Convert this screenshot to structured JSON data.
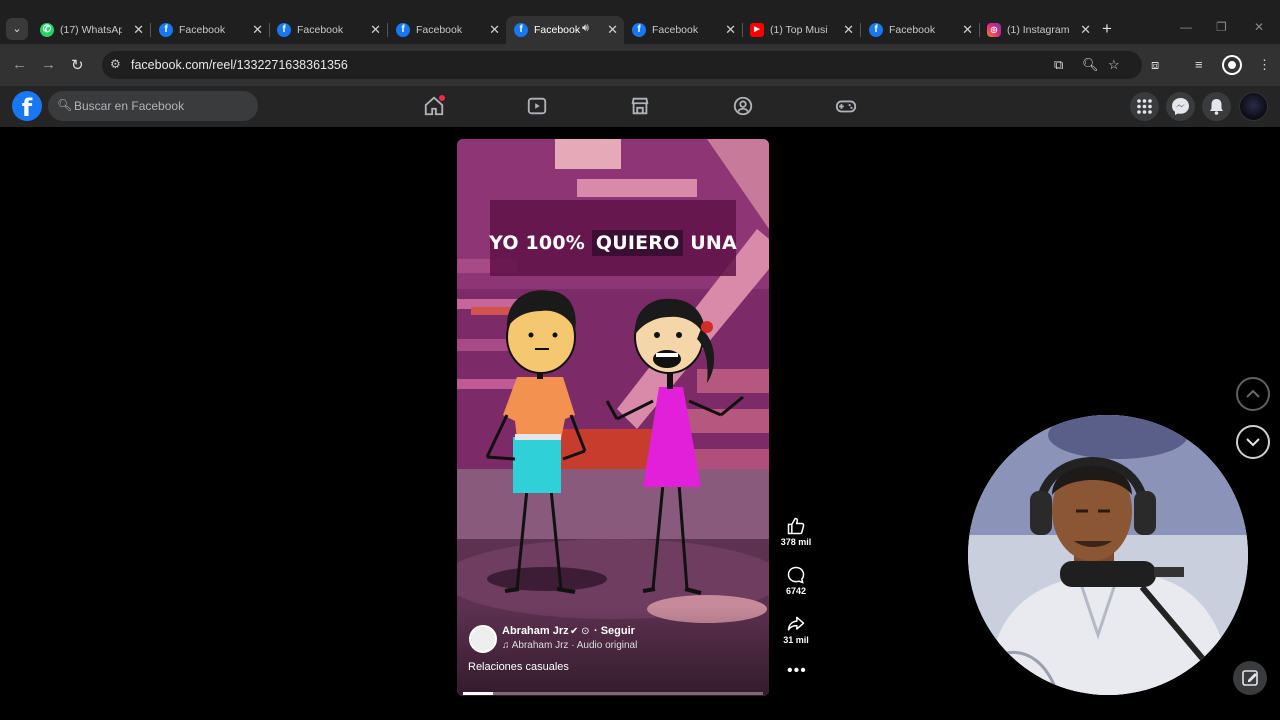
{
  "browser": {
    "tabs": [
      {
        "title": "(17) WhatsApp",
        "favicon": "whatsapp-icon",
        "active": false
      },
      {
        "title": "Facebook",
        "favicon": "facebook-icon",
        "active": false
      },
      {
        "title": "Facebook",
        "favicon": "facebook-icon",
        "active": false
      },
      {
        "title": "Facebook",
        "favicon": "facebook-icon",
        "active": false
      },
      {
        "title": "Facebook",
        "favicon": "facebook-icon",
        "active": true,
        "audio": true
      },
      {
        "title": "Facebook",
        "favicon": "facebook-icon",
        "active": false
      },
      {
        "title": "(1) Top Musi",
        "favicon": "youtube-icon",
        "active": false
      },
      {
        "title": "Facebook",
        "favicon": "facebook-icon",
        "active": false
      },
      {
        "title": "(1) Instagram",
        "favicon": "instagram-icon",
        "active": false
      }
    ],
    "url": "facebook.com/reel/1332271638361356"
  },
  "facebook": {
    "logo": "f",
    "search_placeholder": "Buscar en Facebook"
  },
  "reel": {
    "caption_before": "YO 100%",
    "caption_highlight": "QUIERO",
    "caption_after": "UNA",
    "author": "Abraham Jrz",
    "follow_label": "· Seguir",
    "audio": "♫ Abraham Jrz · Audio original",
    "description": "Relaciones casuales",
    "progress": 0.1
  },
  "actions": {
    "likes": "378 mil",
    "comments": "6742",
    "shares": "31 mil"
  },
  "colors": {
    "facebook_blue": "#1877f2",
    "reel_background": "#6e1f5b",
    "notification_red": "#f02849"
  }
}
